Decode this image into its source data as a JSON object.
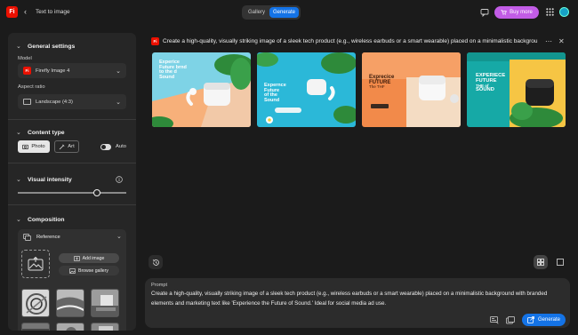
{
  "header": {
    "logo_text": "Fi",
    "back_icon": "chevron-left-icon",
    "title": "Text to image",
    "tabs": [
      "Gallery",
      "Generate"
    ],
    "active_tab": "Generate",
    "buy_label": "Buy more"
  },
  "sidebar": {
    "general": {
      "title": "General settings",
      "model_label": "Model",
      "model_badge": "Fi",
      "model_value": "Firefly Image 4",
      "aspect_label": "Aspect ratio",
      "aspect_value": "Landscape (4:3)"
    },
    "content_type": {
      "title": "Content type",
      "photo": "Photo",
      "art": "Art",
      "auto": "Auto",
      "selected": "Photo"
    },
    "visual_intensity": {
      "title": "Visual intensity",
      "value_fraction": 0.73
    },
    "composition": {
      "title": "Composition",
      "reference_label": "Reference",
      "add_image": "Add image",
      "browse_gallery": "Browse gallery"
    }
  },
  "main": {
    "prompt_badge": "Fi",
    "prompt_heading": "Create a high-quality, visually striking image of a sleek tech product (e.g., wireless earbuds or a smart wearable) placed on a minimalistic backgrou",
    "images": [
      {
        "headline_lines": [
          "Experice",
          "Future brnd",
          "to the d",
          "Sound"
        ],
        "bg": "#7ed3e6",
        "accent": "#f7b07a"
      },
      {
        "headline_lines": [
          "Expernce",
          "Future",
          "of the",
          "Sound"
        ],
        "bg": "#2bb8d8",
        "accent": "#e9f4f6"
      },
      {
        "headline_lines": [
          "Exprecice",
          "FUTURE",
          "The THF"
        ],
        "bg": "#f28a4a",
        "accent": "#f6e3cc"
      },
      {
        "headline_lines": [
          "EXPERIECE",
          "FUTURE",
          "THE of",
          "SOUND"
        ],
        "bg": "#16a9a6",
        "accent": "#f6c544"
      }
    ],
    "prompt": {
      "label": "Prompt",
      "text": "Create a high-quality, visually striking image of a sleek tech product (e.g., wireless earbuds or a smart wearable) placed on a minimalistic background with branded elements and marketing text like 'Experience the Future of Sound.' Ideal for social media ad use."
    },
    "generate_label": "Generate"
  },
  "colors": {
    "accent": "#1473e6",
    "buy": "#c25ce6",
    "brand": "#eb1000"
  }
}
